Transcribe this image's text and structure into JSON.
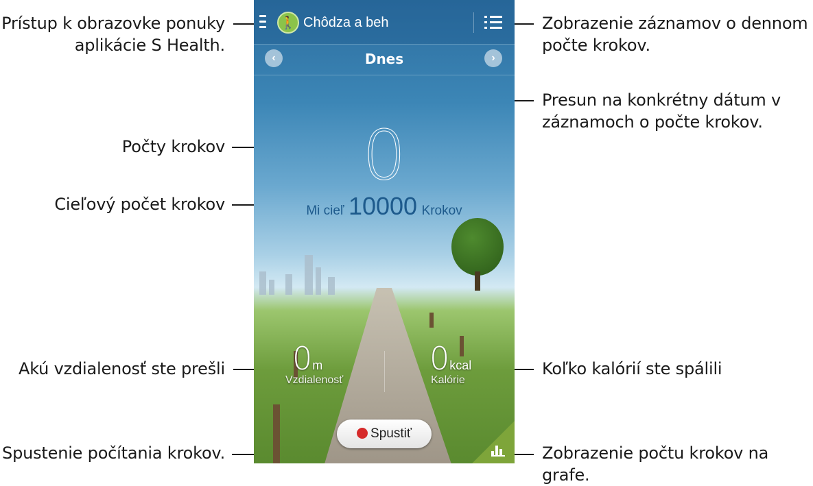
{
  "callouts": {
    "menu": "Prístup k obrazovke ponuky aplikácie S Health.",
    "menu_line1": "Prístup k obrazovke ponuky",
    "menu_line2": "aplikácie S Health.",
    "records_line1": "Zobrazenie záznamov o dennom",
    "records_line2": "počte krokov.",
    "date_line1": "Presun na konkrétny dátum v",
    "date_line2": "záznamoch o počte krokov.",
    "steps": "Počty krokov",
    "goal": "Cieľový počet krokov",
    "distance": "Akú vzdialenosť ste prešli",
    "calories": "Koľko kalórií ste spálili",
    "start": "Spustenie počítania krokov.",
    "graph": "Zobrazenie počtu krokov na grafe."
  },
  "app": {
    "title": "Chôdza a beh",
    "date_label": "Dnes",
    "step_count": "0",
    "goal_prefix": "Mi cieľ",
    "goal_value": "10000",
    "goal_suffix": "Krokov",
    "distance_value": "0",
    "distance_unit": "m",
    "distance_caption": "Vzdialenosť",
    "calories_value": "0",
    "calories_unit": "kcal",
    "calories_caption": "Kalórie",
    "start_label": "Spustiť"
  },
  "icons": {
    "menu": "menu-icon",
    "app": "walking-person-icon",
    "list": "list-icon",
    "prev": "chevron-left-icon",
    "next": "chevron-right-icon",
    "record": "record-dot-icon",
    "graph": "bar-chart-icon"
  },
  "colors": {
    "accent_green": "#7ea53a",
    "goal_blue": "#1d5a8c",
    "record_red": "#d62a2a"
  }
}
